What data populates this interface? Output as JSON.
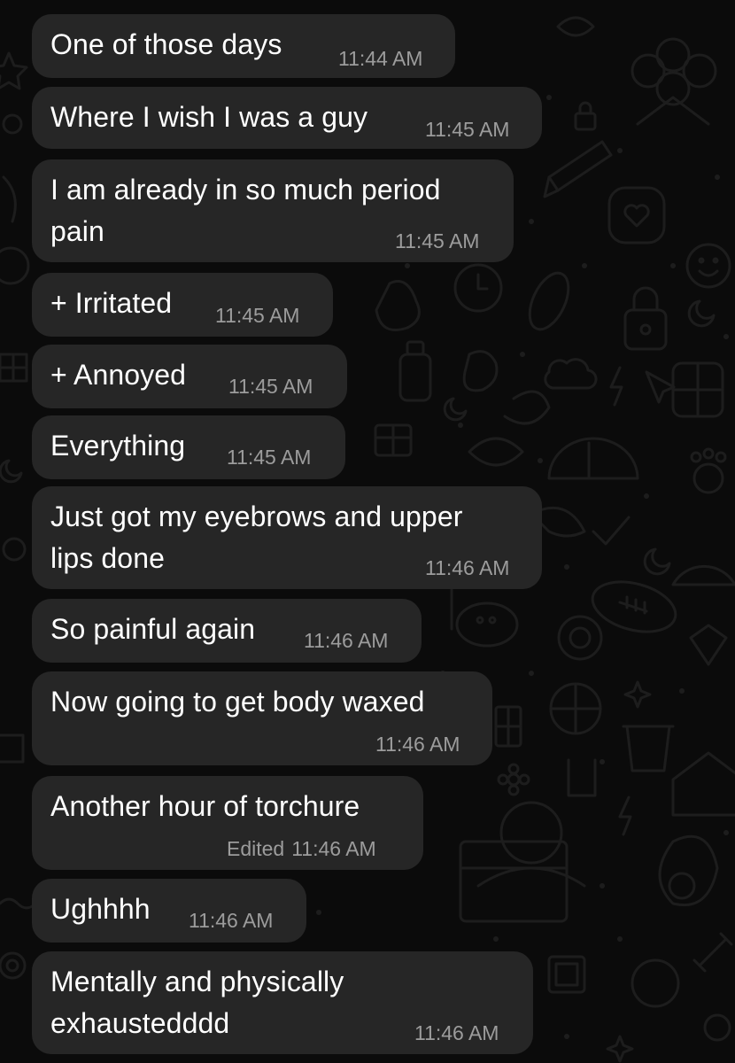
{
  "theme": {
    "background": "#0b0b0b",
    "bubble_color": "#262626",
    "text_color": "#ffffff",
    "timestamp_color": "#9c9c9c",
    "wallpaper_doodle_color": "#1c1c1c"
  },
  "wallpaper": {
    "pattern": "doodle-icons"
  },
  "messages": [
    {
      "lines": [
        "One of those days"
      ],
      "time": "11:44 AM",
      "edited": ""
    },
    {
      "lines": [
        "Where I wish I was a guy"
      ],
      "time": "11:45 AM",
      "edited": ""
    },
    {
      "lines": [
        "I am already in so much period",
        "pain"
      ],
      "time": "11:45 AM",
      "edited": ""
    },
    {
      "lines": [
        "+ Irritated"
      ],
      "time": "11:45 AM",
      "edited": ""
    },
    {
      "lines": [
        "+ Annoyed"
      ],
      "time": "11:45 AM",
      "edited": ""
    },
    {
      "lines": [
        "Everything"
      ],
      "time": "11:45 AM",
      "edited": ""
    },
    {
      "lines": [
        "Just got my eyebrows and upper",
        "lips done"
      ],
      "time": "11:46 AM",
      "edited": ""
    },
    {
      "lines": [
        "So painful again"
      ],
      "time": "11:46 AM",
      "edited": ""
    },
    {
      "lines": [
        "Now going to get body waxed"
      ],
      "time": "11:46 AM",
      "edited": ""
    },
    {
      "lines": [
        "Another hour of torchure"
      ],
      "time": "11:46 AM",
      "edited": "Edited"
    },
    {
      "lines": [
        "Ughhhh"
      ],
      "time": "11:46 AM",
      "edited": ""
    },
    {
      "lines": [
        "Mentally and physically",
        "exhaustedddd"
      ],
      "time": "11:46 AM",
      "edited": ""
    }
  ]
}
